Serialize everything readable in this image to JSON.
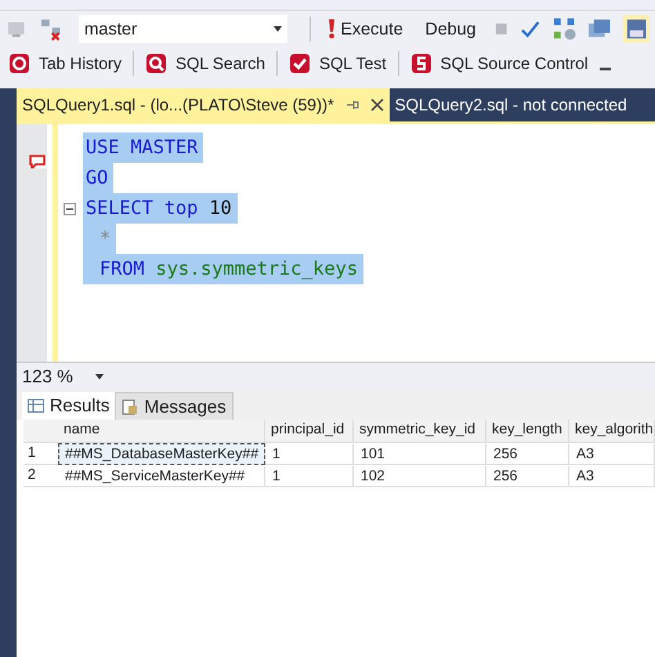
{
  "toolbar": {
    "database": "master",
    "buttons": [
      {
        "label": "Execute",
        "kind": "execute"
      },
      {
        "label": "Debug",
        "kind": "plain"
      }
    ]
  },
  "addin_toolbar": [
    {
      "label": "Tab History"
    },
    {
      "label": "SQL Search"
    },
    {
      "label": "SQL Test"
    },
    {
      "label": "SQL Source Control"
    }
  ],
  "tabs": [
    {
      "label": "SQLQuery1.sql - (lo...(PLATO\\Steve (59))*",
      "selected": true
    },
    {
      "label": "SQLQuery2.sql - not connected",
      "selected": false
    }
  ],
  "code": [
    {
      "collapsible": false,
      "indented": false,
      "tokens": [
        {
          "text": "USE",
          "kind": "keyword"
        },
        {
          "text": "MASTER",
          "kind": "keyword"
        }
      ]
    },
    {
      "collapsible": false,
      "indented": false,
      "tokens": [
        {
          "text": "GO",
          "kind": "keyword"
        }
      ]
    },
    {
      "collapsible": true,
      "indented": false,
      "tokens": [
        {
          "text": "SELECT",
          "kind": "keyword"
        },
        {
          "text": "top",
          "kind": "keyword"
        },
        {
          "text": "10",
          "kind": "number"
        }
      ]
    },
    {
      "collapsible": false,
      "indented": true,
      "tokens": [
        {
          "text": "*",
          "kind": "operator"
        }
      ]
    },
    {
      "collapsible": false,
      "indented": true,
      "tokens": [
        {
          "text": "FROM",
          "kind": "keyword"
        },
        {
          "text": "sys.symmetric_keys",
          "kind": "system"
        }
      ]
    }
  ],
  "zoom": "123 %",
  "result_tabs": [
    {
      "label": "Results",
      "selected": true
    },
    {
      "label": "Messages",
      "selected": false
    }
  ],
  "table": {
    "columns": [
      "name",
      "principal_id",
      "symmetric_key_id",
      "key_length",
      "key_algorith"
    ],
    "rows": [
      {
        "number": "1",
        "cells": [
          "##MS_DatabaseMasterKey##",
          "1",
          "101",
          "256",
          "A3"
        ],
        "selected": true
      },
      {
        "number": "2",
        "cells": [
          "##MS_ServiceMasterKey##",
          "1",
          "102",
          "256",
          "A3"
        ],
        "selected": false
      }
    ]
  }
}
